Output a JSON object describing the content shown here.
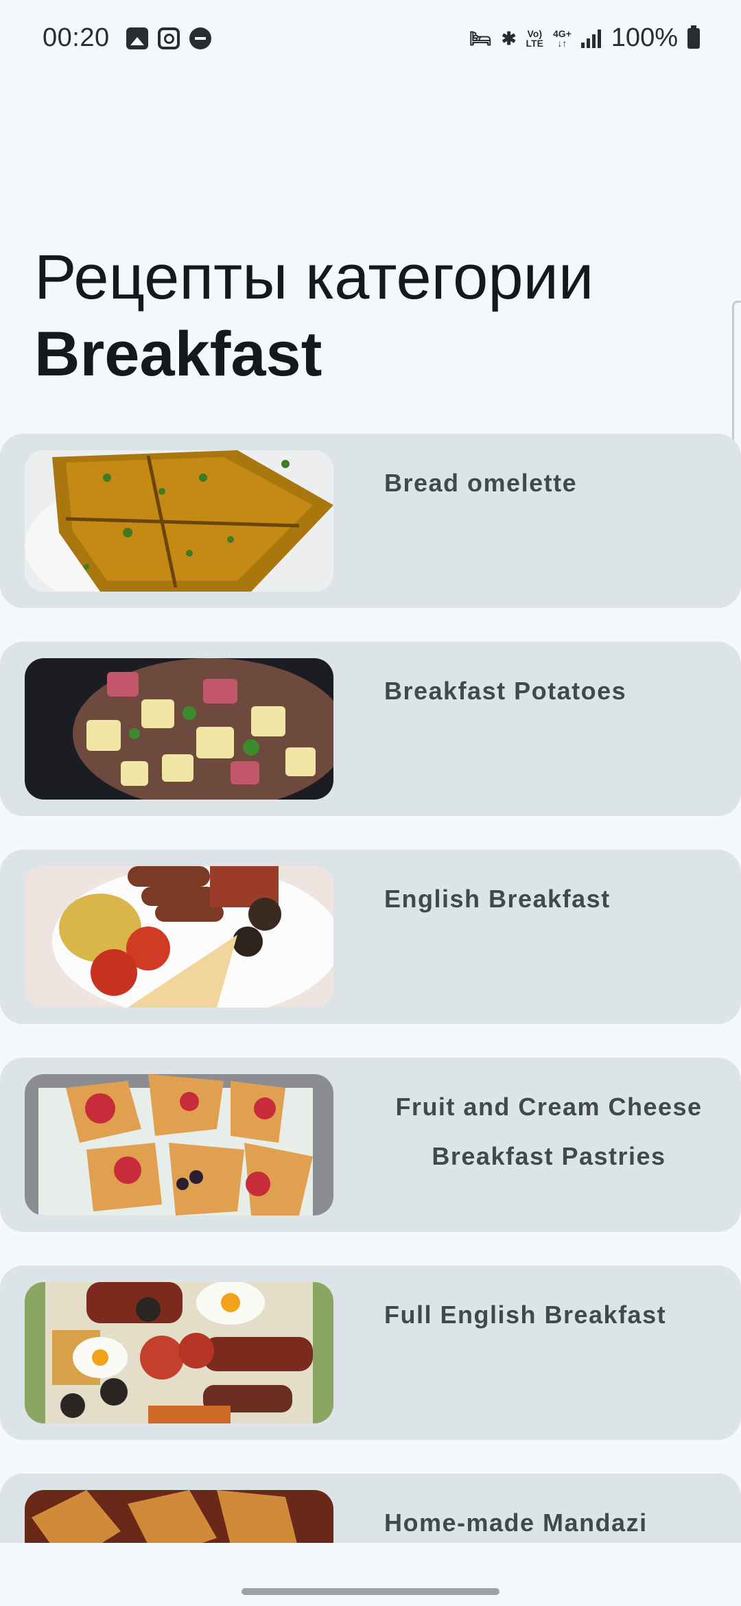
{
  "status_bar": {
    "time": "00:20",
    "battery": "100%",
    "network_top": "Vo)",
    "network_bottom": "LTE",
    "gen_top": "4G+",
    "gen_bottom": "↓↑"
  },
  "header": {
    "title_line1": "Рецепты категории",
    "title_line2": "Breakfast"
  },
  "recipes": [
    {
      "name": "Bread omelette",
      "image": "bread-omelette-photo"
    },
    {
      "name": "Breakfast Potatoes",
      "image": "breakfast-potatoes-photo"
    },
    {
      "name": "English Breakfast",
      "image": "english-breakfast-photo"
    },
    {
      "name": "Fruit and Cream Cheese Breakfast Pastries",
      "image": "fruit-pastries-photo"
    },
    {
      "name": "Full English Breakfast",
      "image": "full-english-breakfast-photo"
    },
    {
      "name": "Home-made Mandazi",
      "image": "mandazi-photo"
    }
  ],
  "colors": {
    "background": "#f4f8fb",
    "card": "#dde4e7",
    "card_text": "#41494e"
  }
}
